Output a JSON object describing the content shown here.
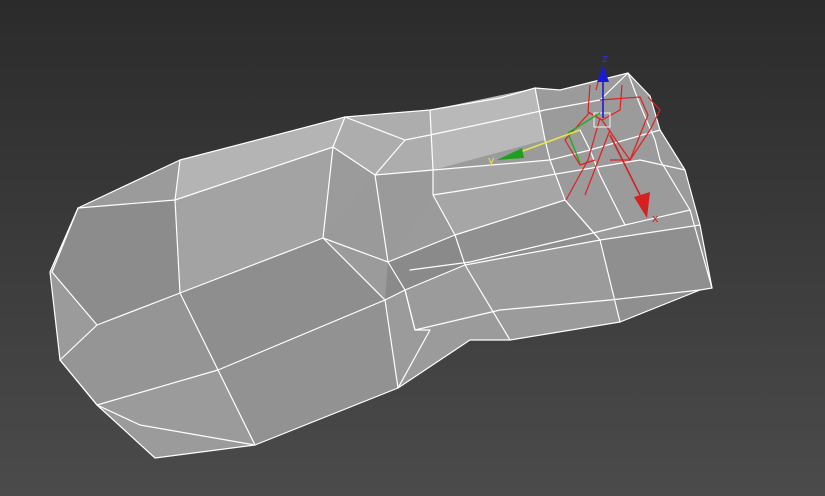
{
  "viewport": {
    "type": "3d-perspective-viewport",
    "background_top": "#2e2e2e",
    "background_bottom": "#4a4a4a",
    "mesh_color": "#9e9e9e",
    "wire_color": "#ffffff"
  },
  "gizmo": {
    "axes": [
      {
        "label": "x",
        "color": "#d42020"
      },
      {
        "label": "y",
        "color": "#e6e64c"
      },
      {
        "label": "z",
        "color": "#1a1ad4"
      }
    ],
    "bone_color": "#e02020",
    "plane_color_green": "#22aa22"
  }
}
